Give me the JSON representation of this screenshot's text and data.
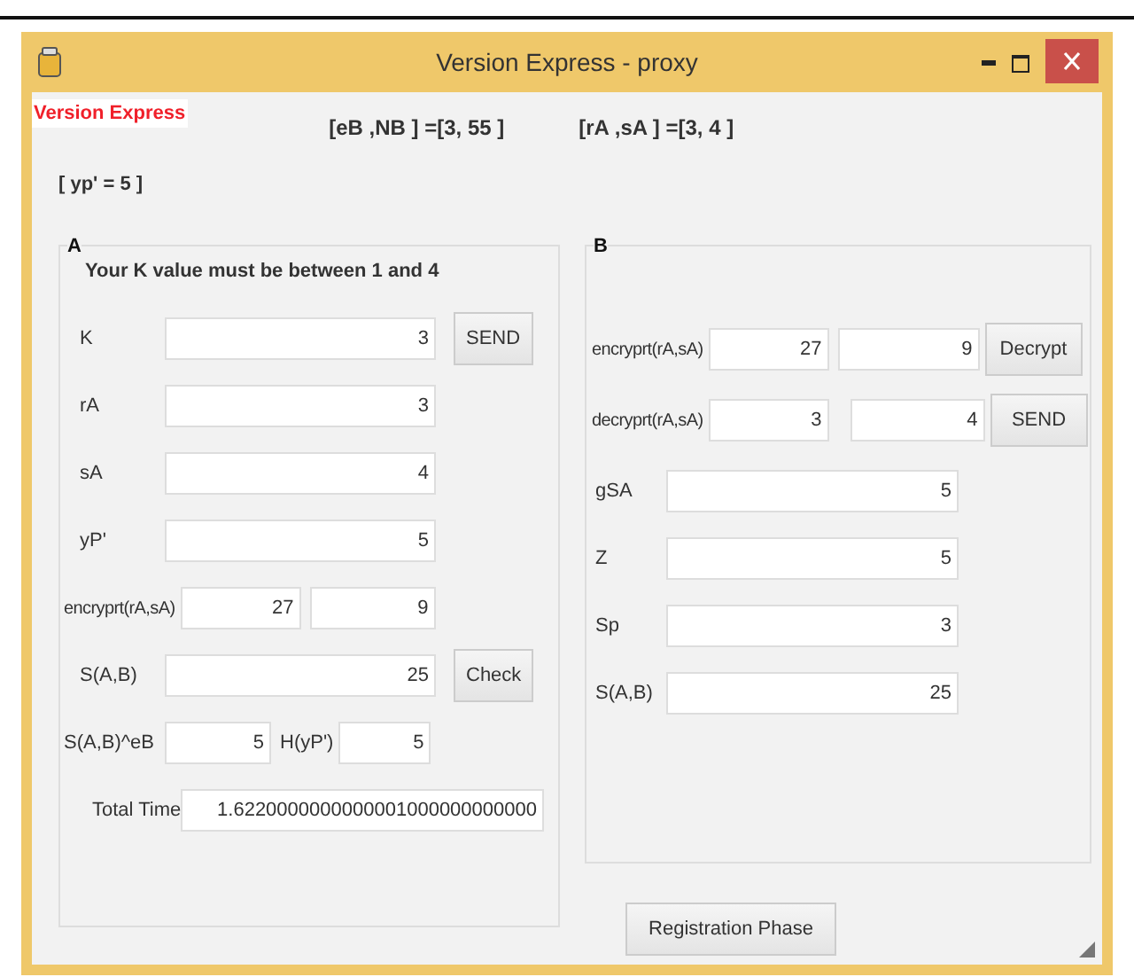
{
  "window": {
    "title": "Version Express - proxy"
  },
  "header": {
    "app_label": "Version Express",
    "params": [
      "[eB ,NB ] =[3, 55 ]",
      "[rA ,sA ] =[3, 4 ]"
    ],
    "yp": "[ yp' = 5 ]"
  },
  "panel_a": {
    "title": "A",
    "note": "Your K value must be between 1 and 4",
    "rows": [
      {
        "kind": "field",
        "label": "K",
        "values": [
          "3"
        ],
        "button": "SEND"
      },
      {
        "kind": "field",
        "label": "rA",
        "values": [
          "3"
        ]
      },
      {
        "kind": "field",
        "label": "sA",
        "values": [
          "4"
        ]
      },
      {
        "kind": "field",
        "label": "yP'",
        "values": [
          "5"
        ]
      },
      {
        "kind": "split",
        "label": "encryprt(rA,sA)",
        "values": [
          "27",
          "9"
        ]
      },
      {
        "kind": "field",
        "label": "S(A,B)",
        "values": [
          "25"
        ],
        "button": "Check"
      },
      {
        "kind": "pair",
        "label": "S(A,B)^eB",
        "values": [
          "5"
        ],
        "label2": "H(yP')",
        "values2": [
          "5"
        ]
      },
      {
        "kind": "wide",
        "label": "Total Time",
        "values": [
          "1.6220000000000001000000000000"
        ]
      }
    ]
  },
  "panel_b": {
    "title": "B",
    "rows": [
      {
        "kind": "split",
        "label": "encryprt(rA,sA)",
        "values": [
          "27",
          "9"
        ],
        "button": "Decrypt"
      },
      {
        "kind": "split",
        "label": "decryprt(rA,sA)",
        "values": [
          "3",
          "4"
        ],
        "button": "SEND"
      },
      {
        "kind": "field",
        "label": "gSA",
        "values": [
          "5"
        ]
      },
      {
        "kind": "field",
        "label": "Z",
        "values": [
          "5"
        ]
      },
      {
        "kind": "field",
        "label": "Sp",
        "values": [
          "3"
        ]
      },
      {
        "kind": "field",
        "label": "S(A,B)",
        "values": [
          "25"
        ]
      }
    ]
  },
  "footer_button": "Registration Phase"
}
